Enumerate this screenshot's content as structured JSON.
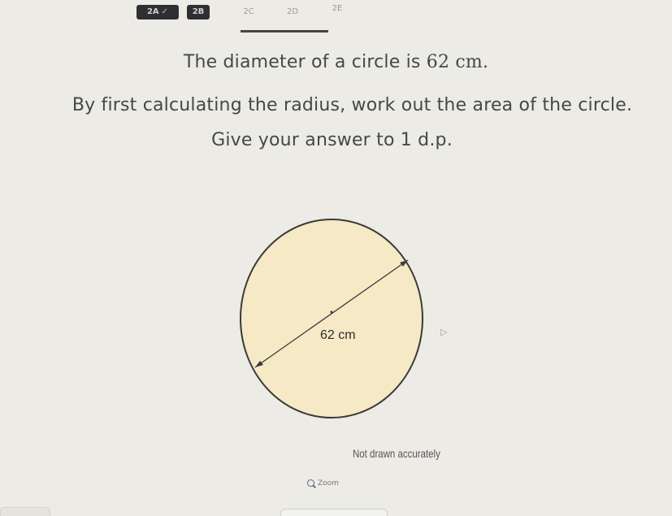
{
  "tabs": [
    {
      "label": "2A",
      "state": "done",
      "check": "✓"
    },
    {
      "label": "2B",
      "state": "done"
    },
    {
      "label": "2C",
      "state": "current"
    },
    {
      "label": "2D",
      "state": "todo"
    },
    {
      "label": "2E",
      "state": "todo"
    }
  ],
  "question": {
    "line1_prefix": "The diameter of a circle is ",
    "line1_value": "62 cm.",
    "line2": "By first calculating the radius, work out the area of the circle.",
    "line3": "Give your answer to 1 d.p."
  },
  "diagram": {
    "label": "62 cm",
    "fill_color": "#f5e9c6",
    "stroke_color": "#3a3a3a",
    "caption": "Not drawn accurately"
  },
  "zoom": {
    "label": "Zoom",
    "icon": "magnifier-icon"
  },
  "colors": {
    "background": "#ecebe5",
    "text": "#45474b",
    "tab_done": "#2f2f33"
  }
}
